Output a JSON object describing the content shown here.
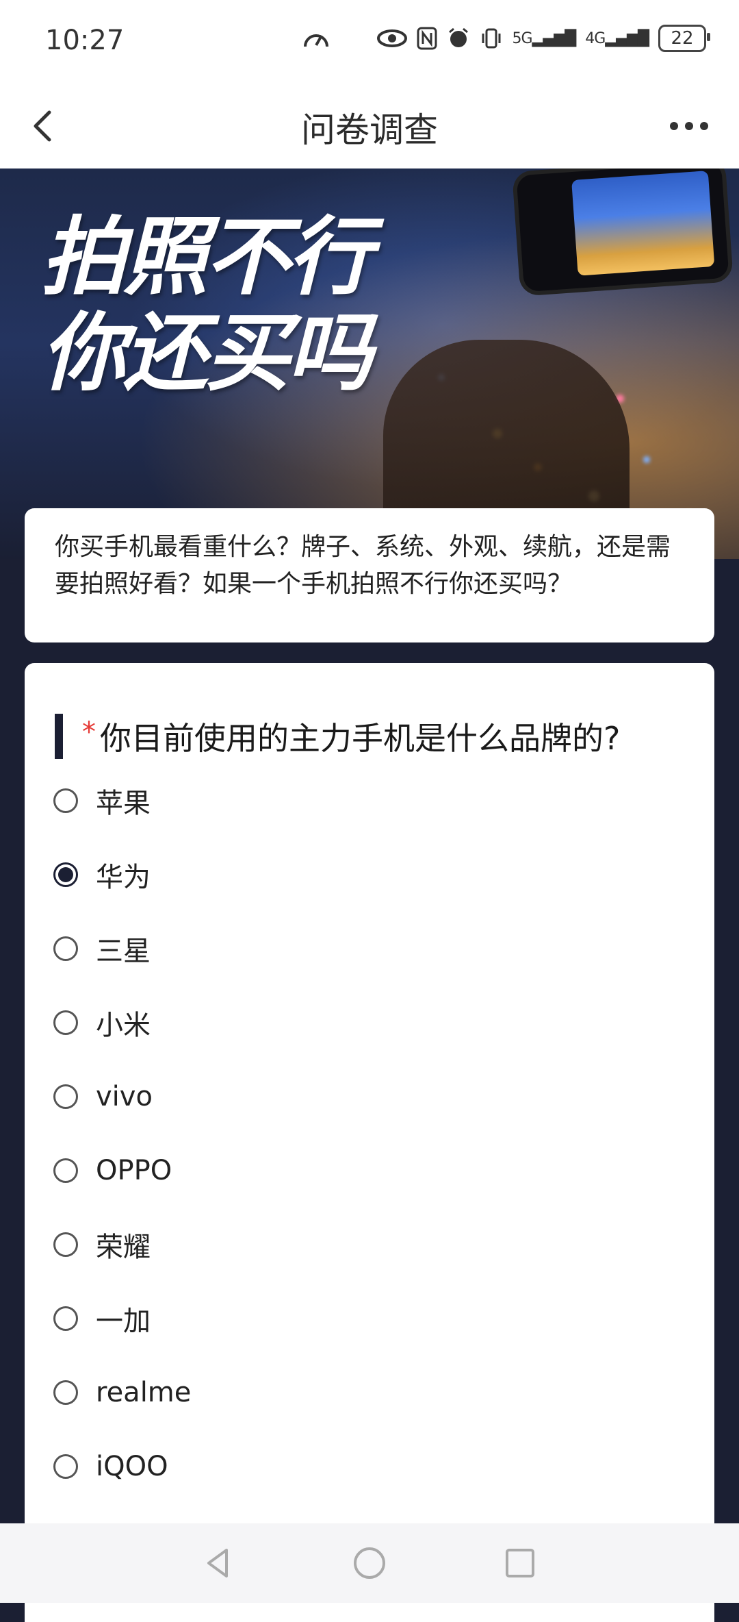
{
  "status_bar": {
    "time": "10:27",
    "network_1": "5G",
    "network_2": "4G",
    "battery": "22"
  },
  "header": {
    "title": "问卷调查"
  },
  "hero": {
    "title_line1": "拍照不行",
    "title_line2": "你还买吗"
  },
  "intro": {
    "text": "你买手机最看重什么？牌子、系统、外观、续航，还是需要拍照好看？如果一个手机拍照不行你还买吗？"
  },
  "question": {
    "required_mark": "*",
    "title": "你目前使用的主力手机是什么品牌的?",
    "selected": "华为",
    "options": [
      {
        "label": "苹果",
        "checked": false
      },
      {
        "label": "华为",
        "checked": true
      },
      {
        "label": "三星",
        "checked": false
      },
      {
        "label": "小米",
        "checked": false
      },
      {
        "label": "vivo",
        "checked": false
      },
      {
        "label": "OPPO",
        "checked": false
      },
      {
        "label": "荣耀",
        "checked": false
      },
      {
        "label": "一加",
        "checked": false
      },
      {
        "label": "realme",
        "checked": false
      },
      {
        "label": "iQOO",
        "checked": false
      }
    ]
  },
  "colors": {
    "accent": "#1b1f33",
    "required": "#e53935",
    "background": "#1b1f33"
  },
  "nav_bar": {
    "icons": [
      "back-triangle-icon",
      "home-circle-icon",
      "recents-square-icon"
    ]
  }
}
